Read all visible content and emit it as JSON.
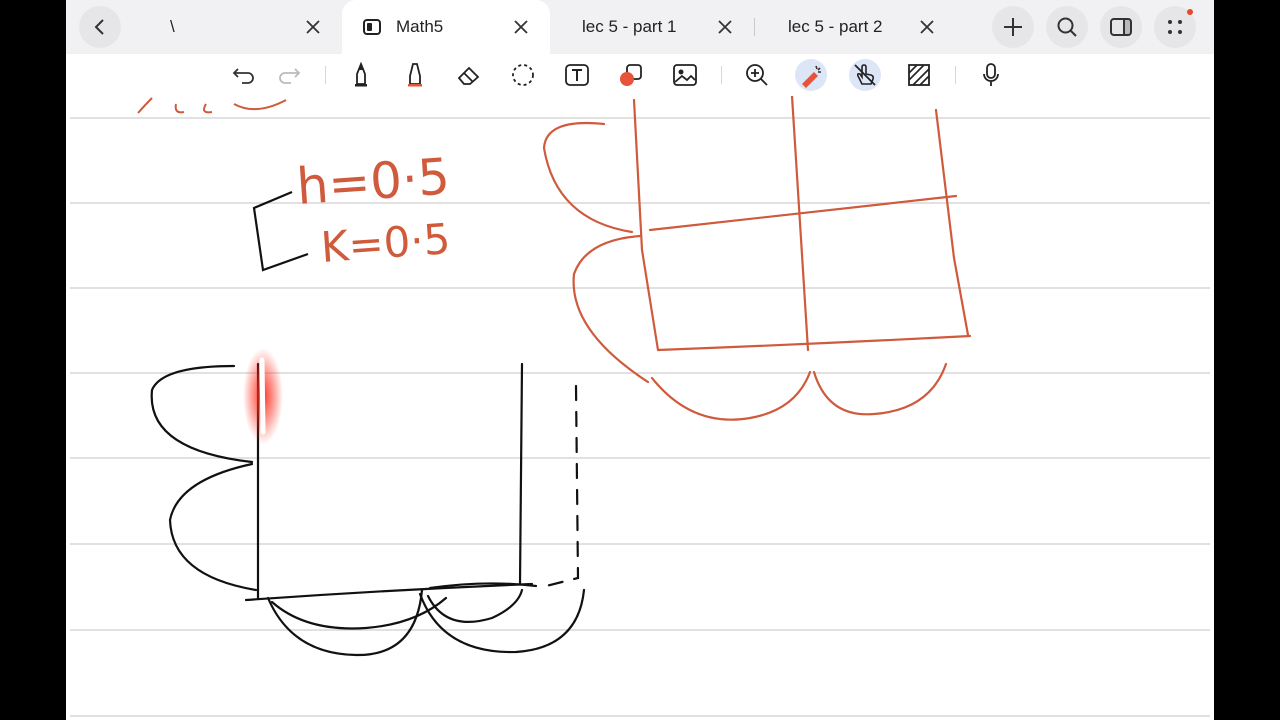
{
  "tabs": [
    {
      "label": "\\",
      "active": false
    },
    {
      "label": "Math5",
      "active": true
    },
    {
      "label": "lec 5 - part 1",
      "active": false
    },
    {
      "label": "lec 5 - part 2",
      "active": false
    }
  ],
  "tab_actions": [
    "add-icon",
    "search-icon",
    "split-view-icon",
    "more-icon"
  ],
  "toolbar": {
    "tools": [
      "undo",
      "redo",
      "pen",
      "highlighter",
      "eraser",
      "lasso",
      "text",
      "shapes",
      "image",
      "zoom",
      "laser-pointer",
      "touch-draw",
      "ruler",
      "microphone"
    ],
    "selected": [
      "laser-pointer",
      "touch-draw"
    ]
  },
  "note": {
    "line1": "h=0·5",
    "line2": "K=0·5"
  },
  "colors": {
    "ink_red": "#cf5a3c",
    "ink_black": "#111111",
    "rule_line": "#d7d7d7",
    "tab_bar": "#f1f1f3",
    "selected_tool": "#dde6f7",
    "laser": "#ff2a1a"
  }
}
